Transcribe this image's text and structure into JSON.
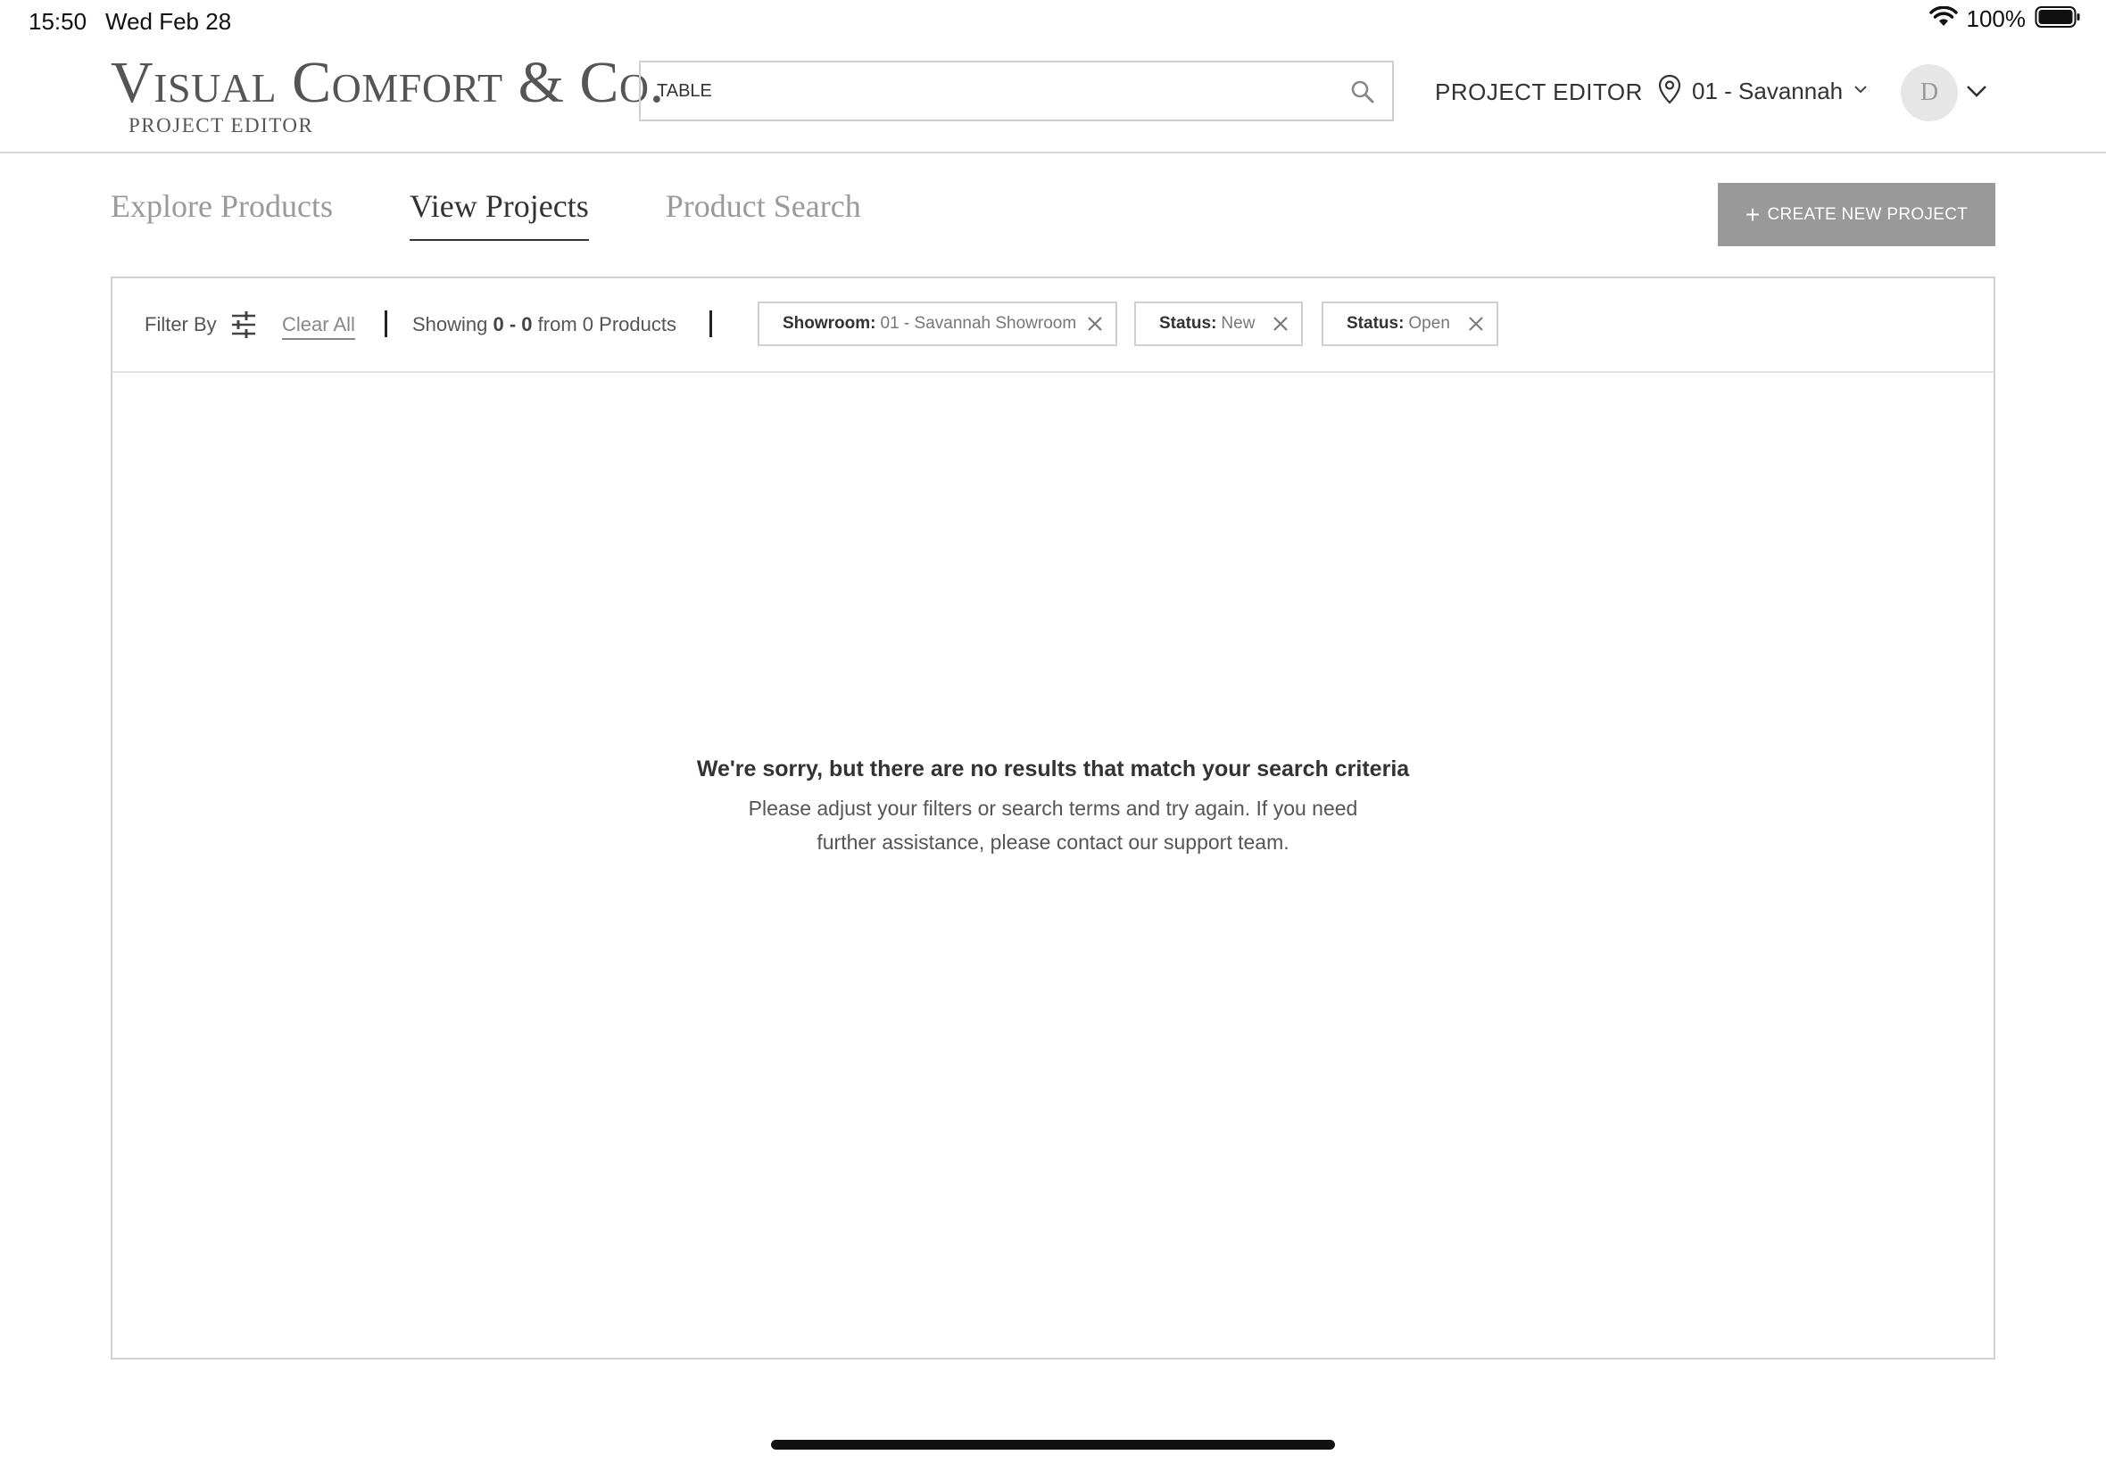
{
  "status_bar": {
    "time": "15:50",
    "date": "Wed Feb 28",
    "battery": "100%"
  },
  "header": {
    "logo": "Visual Comfort & Co.",
    "logo_subtitle": "PROJECT EDITOR",
    "search": {
      "value": "TABLE",
      "placeholder": ""
    },
    "project_editor_link": "PROJECT EDITOR",
    "location": "01 - Savannah",
    "avatar_initial": "D"
  },
  "tabs": [
    {
      "label": "Explore Products",
      "active": false
    },
    {
      "label": "View Projects",
      "active": true
    },
    {
      "label": "Product Search",
      "active": false
    }
  ],
  "create_button": {
    "icon": "+",
    "label": "CREATE NEW PROJECT"
  },
  "filter_bar": {
    "filter_by": "Filter By",
    "clear_all": "Clear All",
    "showing_prefix": "Showing",
    "showing_range": "0 - 0",
    "showing_from": "from",
    "showing_count": "0 Products",
    "chips": [
      {
        "key": "Showroom:",
        "value": "01 - Savannah Showroom"
      },
      {
        "key": "Status:",
        "value": "New"
      },
      {
        "key": "Status:",
        "value": "Open"
      }
    ]
  },
  "empty_state": {
    "title": "We're sorry, but there are no results that match your search criteria",
    "body": "Please adjust your filters or search terms and try again. If you need further assistance, please contact our support team."
  },
  "colors": {
    "button_bg": "#999999",
    "text_primary": "#333333",
    "tab_inactive": "#9a9a9a",
    "border": "#d0d0d0"
  }
}
